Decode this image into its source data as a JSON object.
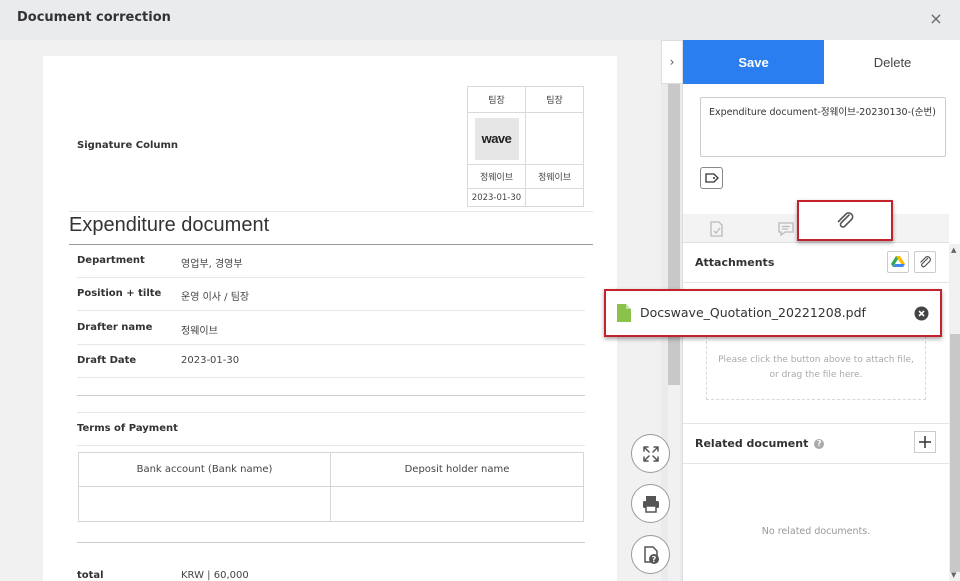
{
  "window": {
    "title": "Document correction",
    "close_icon": "×"
  },
  "document": {
    "signature_label": "Signature Column",
    "signature_table": {
      "headers": [
        "팀장",
        "팀장"
      ],
      "stamp_text": "wave",
      "names": [
        "정웨이브",
        "정웨이브"
      ],
      "date": "2023-01-30"
    },
    "title": "Expenditure document",
    "fields": [
      {
        "label": "Department",
        "value": "영업부, 경영부"
      },
      {
        "label": "Position + tilte",
        "value": "운영 이사 / 팀장"
      },
      {
        "label": "Drafter name",
        "value": "정웨이브"
      },
      {
        "label": "Draft Date",
        "value": "2023-01-30"
      }
    ],
    "terms_label": "Terms of Payment",
    "payment_table": {
      "headers": [
        "Bank account (Bank name)",
        "Deposit holder name"
      ]
    },
    "total": {
      "label": "total",
      "value": "KRW | 60,000"
    }
  },
  "panel": {
    "save_label": "Save",
    "delete_label": "Delete",
    "doc_title_value": "Expenditure document-정웨이브-20230130-(순번)",
    "attachments_title": "Attachments",
    "attached_file": "Docswave_Quotation_20221208.pdf",
    "dropzone_text": "Please click the button above to attach file, or drag the file here.",
    "related_title": "Related document",
    "no_related": "No related documents."
  },
  "colors": {
    "accent": "#2b7ef0",
    "highlight": "#c4222a"
  }
}
